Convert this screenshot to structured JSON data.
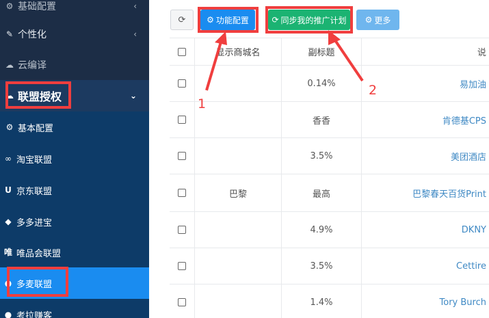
{
  "sidebar": {
    "items": [
      {
        "label": "基础配置",
        "icon": "gear-icon"
      },
      {
        "label": "个性化",
        "icon": "wrench-icon"
      },
      {
        "label": "云编译",
        "icon": "cloud-icon"
      },
      {
        "label": "联盟授权",
        "icon": "cloud-icon"
      },
      {
        "label": "基本配置",
        "icon": "gear-icon"
      },
      {
        "label": "淘宝联盟",
        "icon": "infinity-icon"
      },
      {
        "label": "京东联盟",
        "icon": "u-icon"
      },
      {
        "label": "多多进宝",
        "icon": "diamond-icon"
      },
      {
        "label": "唯品会联盟",
        "icon": "vip-icon"
      },
      {
        "label": "多麦联盟",
        "icon": "circle-icon"
      },
      {
        "label": "考拉赚客",
        "icon": "circle-icon"
      }
    ]
  },
  "toolbar": {
    "refresh_icon": "refresh-icon",
    "feature_label": "功能配置",
    "sync_label": "同步我的推广计划",
    "more_label": "更多"
  },
  "table": {
    "headers": {
      "name": "显示商城名",
      "subtitle": "副标题",
      "desc": "说"
    },
    "rows": [
      {
        "name": "",
        "subtitle": "0.14%",
        "desc": "易加油"
      },
      {
        "name": "",
        "subtitle": "香香",
        "desc": "肯德基CPS"
      },
      {
        "name": "",
        "subtitle": "3.5%",
        "desc": "美团酒店"
      },
      {
        "name": "巴黎",
        "subtitle": "最高",
        "desc": "巴黎春天百货Print"
      },
      {
        "name": "",
        "subtitle": "4.9%",
        "desc": "DKNY"
      },
      {
        "name": "",
        "subtitle": "3.5%",
        "desc": "Cettire"
      },
      {
        "name": "",
        "subtitle": "1.4%",
        "desc": "Tory Burch"
      }
    ]
  },
  "annotations": {
    "one": "1",
    "two": "2"
  },
  "colors": {
    "sidebar": "#1c2d46",
    "active": "#1a8cf0",
    "sync": "#1bb372",
    "annotation": "#f03e3e",
    "link": "#3f89c4"
  }
}
